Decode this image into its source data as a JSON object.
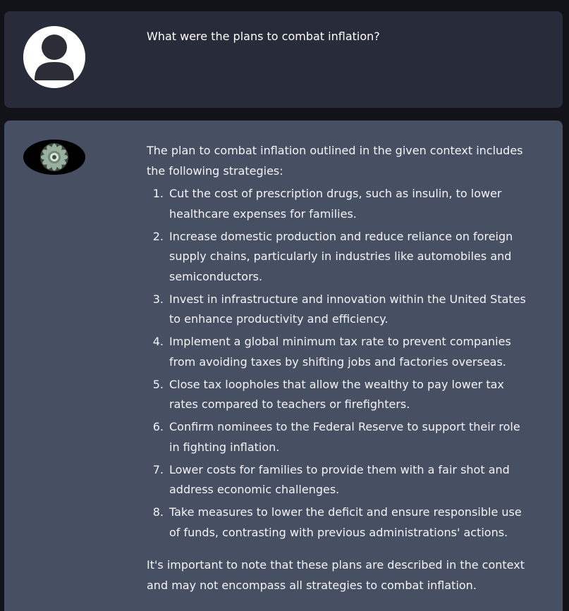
{
  "conversation": {
    "user_message": {
      "avatar_icon": "user-silhouette-icon",
      "text": "What were the plans to combat inflation?"
    },
    "assistant_message": {
      "avatar_icon": "mandala-icon",
      "intro": "The plan to combat inflation outlined in the given context includes the following strategies:",
      "items": [
        {
          "number": "1.",
          "text": "Cut the cost of prescription drugs, such as insulin, to lower healthcare expenses for families."
        },
        {
          "number": "2.",
          "text": "Increase domestic production and reduce reliance on foreign supply chains, particularly in industries like automobiles and semiconductors."
        },
        {
          "number": "3.",
          "text": "Invest in infrastructure and innovation within the United States to enhance productivity and efficiency."
        },
        {
          "number": "4.",
          "text": "Implement a global minimum tax rate to prevent companies from avoiding taxes by shifting jobs and factories overseas."
        },
        {
          "number": "5.",
          "text": "Close tax loopholes that allow the wealthy to pay lower tax rates compared to teachers or firefighters."
        },
        {
          "number": "6.",
          "text": "Confirm nominees to the Federal Reserve to support their role in fighting inflation."
        },
        {
          "number": "7.",
          "text": "Lower costs for families to provide them with a fair shot and address economic challenges."
        },
        {
          "number": "8.",
          "text": "Take measures to lower the deficit and ensure responsible use of funds, contrasting with previous administrations' actions."
        }
      ],
      "closing": "It's important to note that these plans are described in the context and may not encompass all strategies to combat inflation."
    }
  },
  "colors": {
    "page_background": "#111318",
    "user_bubble": "#282c3a",
    "assistant_bubble": "#474f63",
    "text": "#ffffff"
  }
}
